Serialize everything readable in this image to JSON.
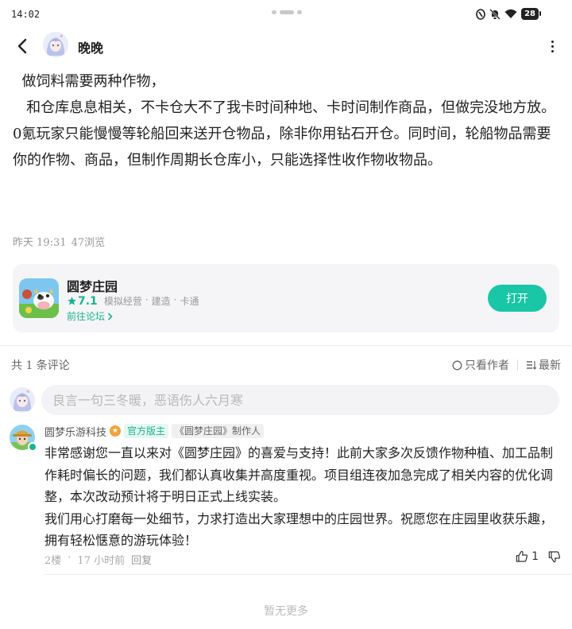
{
  "status_bar": {
    "time": "14:02",
    "battery": "28"
  },
  "header": {
    "username": "晚晚"
  },
  "post": {
    "paragraphs": [
      "  做饲料需要两种作物，",
      "   和仓库息息相关，不卡仓大不了我卡时间种地、卡时间制作商品，但做完没地方放。0氪玩家只能慢慢等轮船回来送开仓物品，除非你用钻石开仓。同时间，轮船物品需要你的作物、商品，但制作周期长仓库小，只能选择性收作物收物品。"
    ],
    "date": "昨天 19:31",
    "views": "47浏览"
  },
  "app_card": {
    "name": "圆梦庄园",
    "rating": "7.1",
    "tags": [
      "模拟经营",
      "·",
      "建造",
      "·",
      "卡通"
    ],
    "forum_link": "前往论坛",
    "open_button": "打开",
    "accent": "#19b38f"
  },
  "comments_bar": {
    "count": "共 1 条评论",
    "only_author": "只看作者",
    "sort": "最新"
  },
  "comment_input": {
    "placeholder": "良言一句三冬暖，恶语伤人六月寒"
  },
  "comment": {
    "author": "圆梦乐游科技",
    "badge_official": "官方版主",
    "badge_role": "《圆梦庄园》制作人",
    "paragraphs": [
      "非常感谢您一直以来对《圆梦庄园》的喜爱与支持！此前大家多次反馈作物种植、加工品制作耗时偏长的问题，我们都认真收集并高度重视。项目组连夜加急完成了相关内容的优化调整，本次改动预计将于明日正式上线实装。",
      "我们用心打磨每一处细节，力求打造出大家理想中的庄园世界。祝愿您在庄园里收获乐趣，拥有轻松惬意的游玩体验！"
    ],
    "floor": "2楼",
    "dot": "·",
    "time": "17 小时前",
    "reply": "回复",
    "likes": "1"
  },
  "footer": {
    "no_more": "暂无更多"
  }
}
